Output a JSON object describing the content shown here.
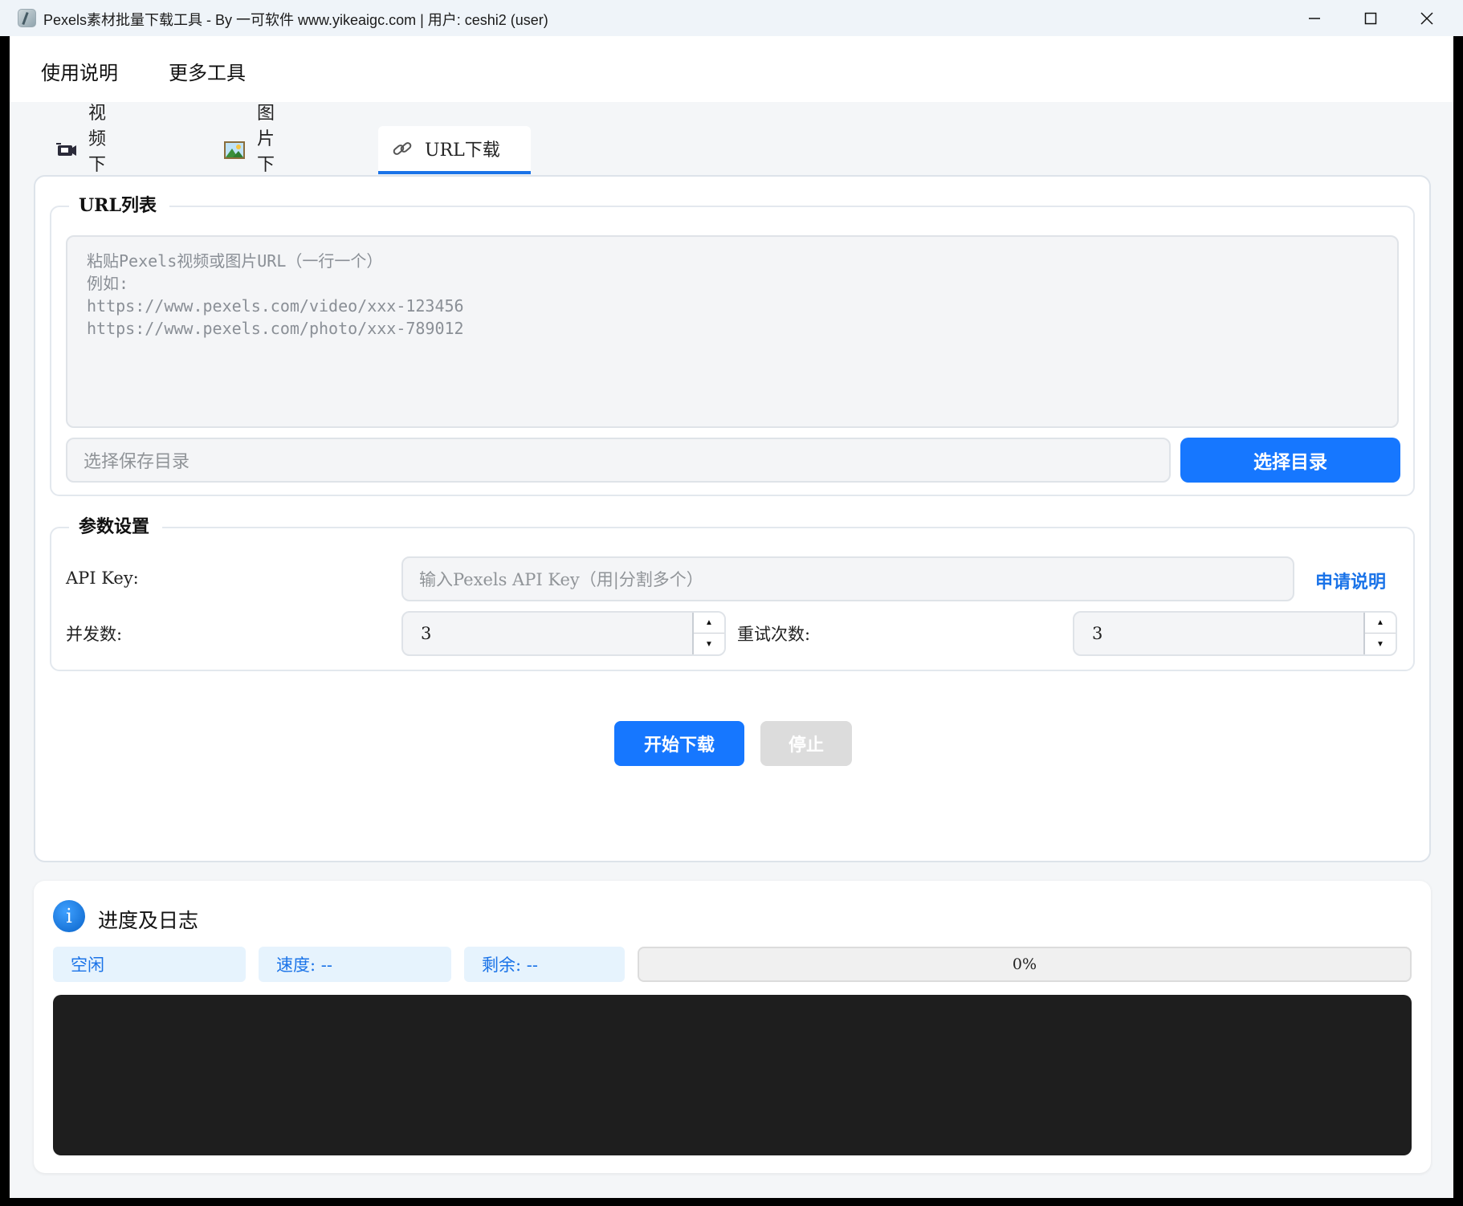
{
  "window": {
    "title": "Pexels素材批量下载工具 - By 一可软件 www.yikeaigc.com | 用户: ceshi2 (user)"
  },
  "menu": {
    "items": [
      "使用说明",
      "更多工具"
    ]
  },
  "tabs": [
    {
      "label": "视频下载",
      "icon": "video-icon"
    },
    {
      "label": "图片下载",
      "icon": "picture-icon"
    },
    {
      "label": "URL下载",
      "icon": "link-icon",
      "active": true
    }
  ],
  "url_group": {
    "legend": "URL列表",
    "placeholder": "粘贴Pexels视频或图片URL（一行一个）\n例如:\nhttps://www.pexels.com/video/xxx-123456\nhttps://www.pexels.com/photo/xxx-789012",
    "dir_placeholder": "选择保存目录",
    "dir_button": "选择目录"
  },
  "params": {
    "legend": "参数设置",
    "api_key_label": "API Key:",
    "api_key_placeholder": "输入Pexels API Key（用|分割多个）",
    "apply_link": "申请说明",
    "concurrency_label": "并发数:",
    "concurrency_value": "3",
    "retry_label": "重试次数:",
    "retry_value": "3"
  },
  "actions": {
    "start": "开始下载",
    "stop": "停止"
  },
  "log": {
    "title": "进度及日志",
    "status": "空闲",
    "speed": "速度: --",
    "remaining": "剩余: --",
    "progress_percent": 0,
    "progress_text": "0%"
  },
  "colors": {
    "accent": "#1677ff",
    "disabled": "#dcdcdc",
    "console_bg": "#1e1e1e"
  }
}
